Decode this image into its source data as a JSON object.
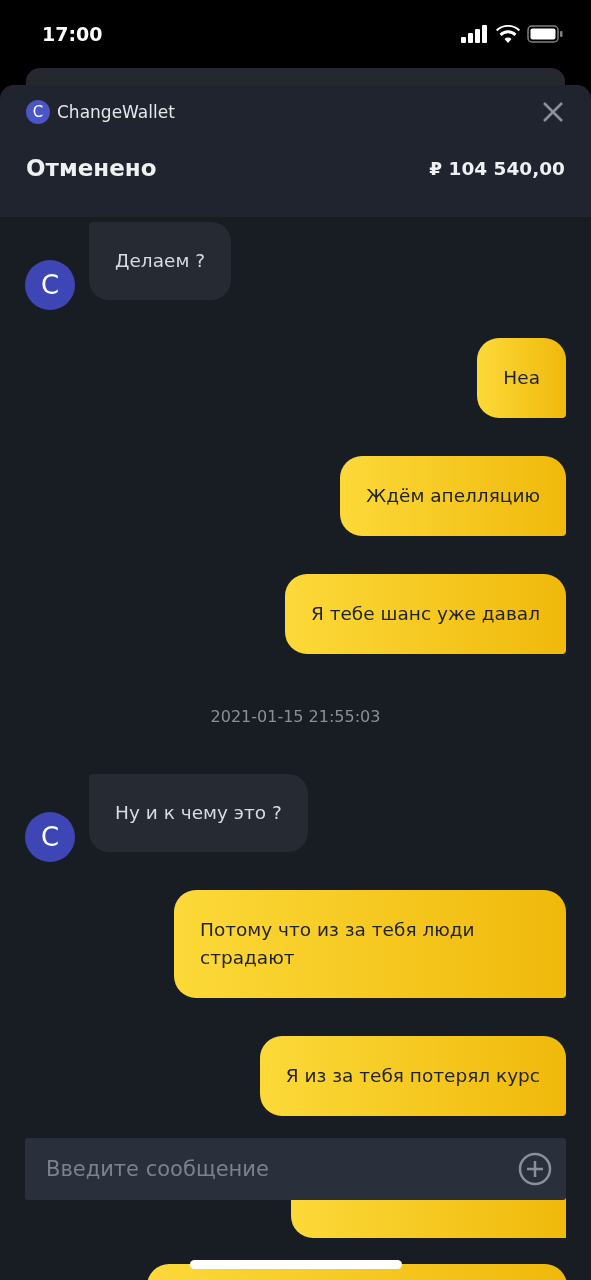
{
  "status_bar": {
    "time": "17:00"
  },
  "header": {
    "app_name": "ChangeWallet",
    "app_initial": "C",
    "status": "Отменено",
    "amount": "₽ 104 540,00"
  },
  "messages": [
    {
      "kind": "incoming",
      "avatar": "C",
      "text": "Делаем ?"
    },
    {
      "kind": "outgoing",
      "text": "Неа"
    },
    {
      "kind": "outgoing",
      "text": "Ждём апелляцию"
    },
    {
      "kind": "outgoing",
      "text": "Я тебе шанс уже давал"
    },
    {
      "kind": "timestamp",
      "text": "2021-01-15 21:55:03"
    },
    {
      "kind": "incoming",
      "avatar": "C",
      "text": "Ну и к чему это ?"
    },
    {
      "kind": "outgoing",
      "text": "Потому что из за тебя люди страдают"
    },
    {
      "kind": "outgoing",
      "text": "Я из за тебя потерял курс"
    }
  ],
  "composer": {
    "placeholder": "Введите сообщение"
  }
}
